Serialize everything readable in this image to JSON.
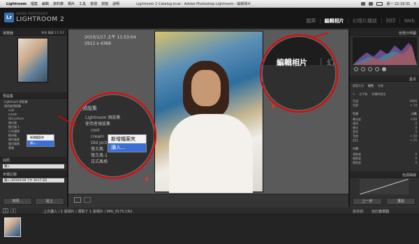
{
  "menubar": {
    "app": "Lightroom",
    "items": [
      "檔案",
      "編輯",
      "資料庫",
      "相片",
      "工具",
      "檢視",
      "視窗",
      "說明"
    ],
    "window_title": "Lightroom 2 Catalog.lrcat - Adobe Photoshop Lightroom - 編輯相片",
    "clock": "週一 22:19:31"
  },
  "identity": {
    "logo": "Lr",
    "line1": "ADOBE PHOTOSHOP",
    "line2": "LIGHTROOM 2"
  },
  "modules": [
    "圖庫",
    "編輯相片",
    "幻燈片播放",
    "列印",
    "Web"
  ],
  "active_module": "編輯相片",
  "left": {
    "navigator": {
      "title": "導覽器",
      "opts": [
        "符合",
        "填滿",
        "1:1",
        "3:1"
      ]
    },
    "presets": {
      "title": "預設集",
      "items": [
        "Lightroom 預設集",
        "使用者預設集",
        "cool",
        "cream",
        "Old picture",
        "復古風",
        "復古風-1",
        "日式風格",
        "歐洲風",
        "綠色漸層",
        "復古風格",
        "素雅"
      ]
    },
    "context_menu": [
      "新增檔案夾",
      "讀入..."
    ],
    "snapshots": {
      "title": "快照",
      "item": "讀入"
    },
    "history": {
      "title": "步驟記錄",
      "item": "讀入 (2010/1/18 下午 10:17:32)"
    },
    "copy_btn": "拷貝...",
    "paste_btn": "貼上"
  },
  "center": {
    "date": "2010/1/17 上午 11:53:04",
    "dims": "2912 x 4368"
  },
  "zoom_menu": {
    "title": "預設集",
    "items": [
      "Lightroom 預設集",
      "使用者預設集",
      "cool",
      "cream",
      "Old picture",
      "復古風",
      "復古風-1",
      "日式風格"
    ],
    "menu": [
      "新增檔案夾",
      "讀入..."
    ]
  },
  "zoom_module": {
    "label": "編輯相片",
    "sep": "|",
    "next": "幻"
  },
  "annotations": {
    "a3": "3",
    "a4": "4"
  },
  "right": {
    "histogram": {
      "title": "色階分佈圖"
    },
    "basic": {
      "title": "基本",
      "treatment_label": "處理方式",
      "treatment": [
        "彩色",
        "灰階"
      ],
      "wb_label": "白平衡",
      "wb_value": "如攝時設定",
      "rows": [
        {
          "label": "色溫",
          "value": "6000"
        },
        {
          "label": "色調",
          "value": "+ 14"
        }
      ],
      "tone_title": "色調",
      "tone_auto": "自動",
      "tone_rows": [
        {
          "label": "曝光度",
          "value": "0.00"
        },
        {
          "label": "復原",
          "value": "0"
        },
        {
          "label": "補光",
          "value": "0"
        },
        {
          "label": "黑色",
          "value": "5"
        },
        {
          "label": "亮度",
          "value": "+ 50"
        },
        {
          "label": "對比",
          "value": "+ 25"
        }
      ],
      "presence_title": "外觀",
      "presence_rows": [
        {
          "label": "清晰度",
          "value": "0"
        },
        {
          "label": "細節度",
          "value": "0"
        },
        {
          "label": "飽和度",
          "value": "0"
        }
      ]
    },
    "tone_curve": {
      "title": "色調曲線"
    },
    "prev_btn": "上一步",
    "reset_btn": "重設"
  },
  "filmstrip": {
    "path": "上次讀入 / 1 張相片 / 選取了 1 張相片 / IMG_8175.CR2",
    "filter_label": "篩選器:",
    "filter_value": "自訂篩選器",
    "page_num": "1",
    "page_num2": "2"
  }
}
